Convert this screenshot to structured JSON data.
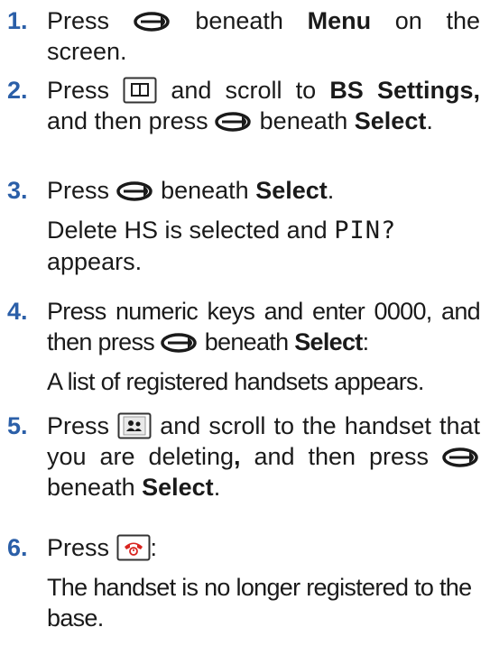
{
  "steps": [
    {
      "num": "1.",
      "a": "Press",
      "b": "beneath",
      "bold1": "Menu",
      "c": "on the screen."
    },
    {
      "num": "2.",
      "a": "Press",
      "b": "and scroll to",
      "bold1": "BS Settings,",
      "c": "and then press",
      "d": "beneath",
      "bold2": "Select",
      "e": "."
    },
    {
      "num": "3.",
      "a": "Press",
      "b": "beneath",
      "bold1": "Select",
      "e": ".",
      "sub1": "Delete HS is selected and",
      "sub_pin": "PIN?",
      "sub2": "appears."
    },
    {
      "num": "4.",
      "a": "Press numeric keys and enter 0000, and then press",
      "b": "beneath",
      "bold1": "Select",
      "e": ":",
      "sub": "A list of registered handsets appears."
    },
    {
      "num": "5.",
      "a": "Press",
      "b": "and scroll to the handset that you are deleting",
      "bold1": ",",
      "c": "and then press",
      "d": "beneath",
      "bold2": "Select",
      "e": "."
    },
    {
      "num": "6.",
      "a": "Press",
      "e": ":",
      "sub": "The handset is no longer registered to the base."
    }
  ],
  "icons": {
    "soft_key": "soft-key-icon",
    "menu_book": "phonebook-key-icon",
    "handset_list": "handset-list-key-icon",
    "end_call": "end-call-key-icon"
  },
  "colors": {
    "step_number": "#2b5fa8",
    "end_call_red": "#d8231e",
    "icon_dark": "#1a1a1a"
  }
}
